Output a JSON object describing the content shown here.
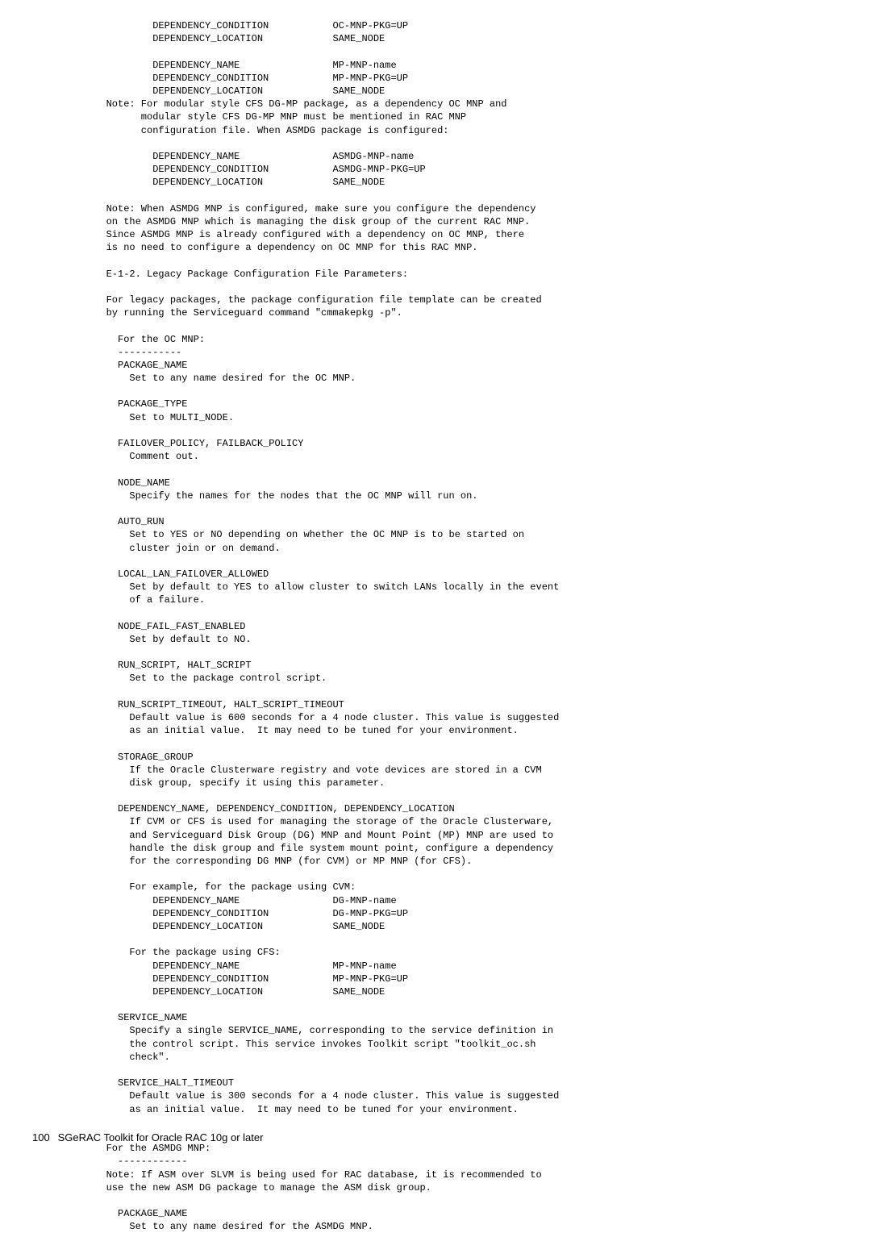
{
  "body": "           DEPENDENCY_CONDITION           OC-MNP-PKG=UP\n           DEPENDENCY_LOCATION            SAME_NODE\n\n           DEPENDENCY_NAME                MP-MNP-name\n           DEPENDENCY_CONDITION           MP-MNP-PKG=UP\n           DEPENDENCY_LOCATION            SAME_NODE\n   Note: For modular style CFS DG-MP package, as a dependency OC MNP and\n         modular style CFS DG-MP MNP must be mentioned in RAC MNP\n         configuration file. When ASMDG package is configured:\n\n           DEPENDENCY_NAME                ASMDG-MNP-name\n           DEPENDENCY_CONDITION           ASMDG-MNP-PKG=UP\n           DEPENDENCY_LOCATION            SAME_NODE\n\n   Note: When ASMDG MNP is configured, make sure you configure the dependency\n   on the ASMDG MNP which is managing the disk group of the current RAC MNP.\n   Since ASMDG MNP is already configured with a dependency on OC MNP, there\n   is no need to configure a dependency on OC MNP for this RAC MNP.\n\n   E-1-2. Legacy Package Configuration File Parameters:\n\n   For legacy packages, the package configuration file template can be created\n   by running the Serviceguard command \"cmmakepkg -p\".\n\n     For the OC MNP:\n     -----------\n     PACKAGE_NAME\n       Set to any name desired for the OC MNP.\n\n     PACKAGE_TYPE\n       Set to MULTI_NODE.\n\n     FAILOVER_POLICY, FAILBACK_POLICY\n       Comment out.\n\n     NODE_NAME\n       Specify the names for the nodes that the OC MNP will run on.\n\n     AUTO_RUN\n       Set to YES or NO depending on whether the OC MNP is to be started on\n       cluster join or on demand.\n\n     LOCAL_LAN_FAILOVER_ALLOWED\n       Set by default to YES to allow cluster to switch LANs locally in the event\n       of a failure.\n\n     NODE_FAIL_FAST_ENABLED\n       Set by default to NO.\n\n     RUN_SCRIPT, HALT_SCRIPT\n       Set to the package control script.\n\n     RUN_SCRIPT_TIMEOUT, HALT_SCRIPT_TIMEOUT\n       Default value is 600 seconds for a 4 node cluster. This value is suggested\n       as an initial value.  It may need to be tuned for your environment.\n\n     STORAGE_GROUP\n       If the Oracle Clusterware registry and vote devices are stored in a CVM\n       disk group, specify it using this parameter.\n\n     DEPENDENCY_NAME, DEPENDENCY_CONDITION, DEPENDENCY_LOCATION\n       If CVM or CFS is used for managing the storage of the Oracle Clusterware,\n       and Serviceguard Disk Group (DG) MNP and Mount Point (MP) MNP are used to\n       handle the disk group and file system mount point, configure a dependency\n       for the corresponding DG MNP (for CVM) or MP MNP (for CFS).\n\n       For example, for the package using CVM:\n           DEPENDENCY_NAME                DG-MNP-name\n           DEPENDENCY_CONDITION           DG-MNP-PKG=UP\n           DEPENDENCY_LOCATION            SAME_NODE\n\n       For the package using CFS:\n           DEPENDENCY_NAME                MP-MNP-name\n           DEPENDENCY_CONDITION           MP-MNP-PKG=UP\n           DEPENDENCY_LOCATION            SAME_NODE\n\n     SERVICE_NAME\n       Specify a single SERVICE_NAME, corresponding to the service definition in\n       the control script. This service invokes Toolkit script \"toolkit_oc.sh\n       check\".\n\n     SERVICE_HALT_TIMEOUT\n       Default value is 300 seconds for a 4 node cluster. This value is suggested\n       as an initial value.  It may need to be tuned for your environment.\n\n\n   For the ASMDG MNP:\n     ------------\n   Note: If ASM over SLVM is being used for RAC database, it is recommended to\n   use the new ASM DG package to manage the ASM disk group.\n\n     PACKAGE_NAME\n       Set to any name desired for the ASMDG MNP.",
  "footer": {
    "page_number": "100",
    "title": "SGeRAC Toolkit for Oracle RAC 10g or later"
  }
}
